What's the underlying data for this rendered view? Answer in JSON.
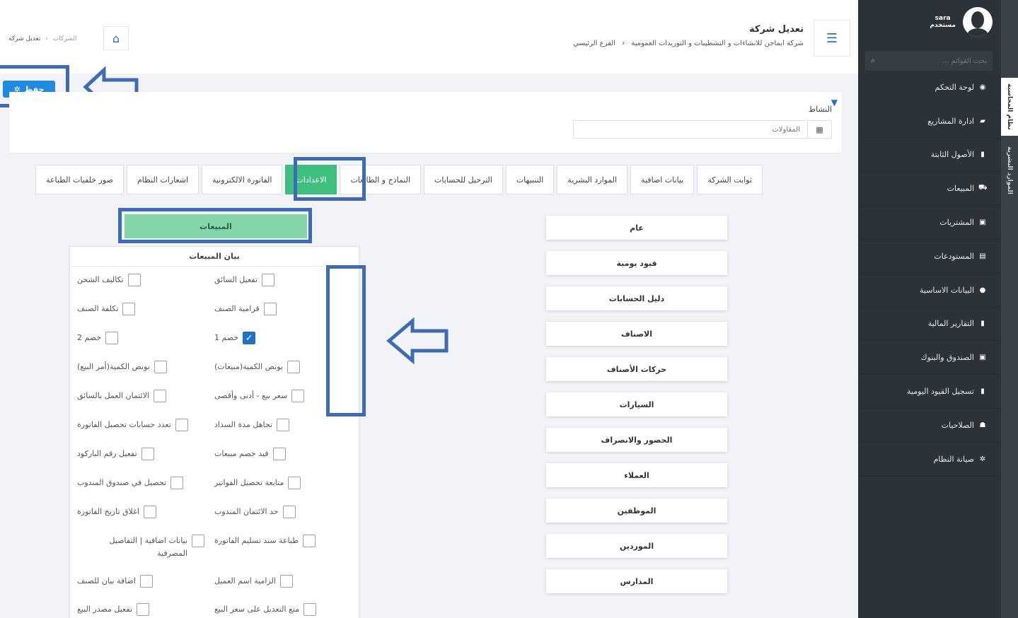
{
  "colors": {
    "accent": "#1e73c8",
    "tab_active": "#3fbf7f",
    "sales_button": "#82d6aa",
    "sidebar": "#2c3338",
    "highlight": "#3f6bb5"
  },
  "sidebar": {
    "user_name": "sara",
    "user_role": "مستخدم",
    "search_placeholder": "بحث القوائم ...",
    "rail_tabs": [
      "نظام المحاسبة",
      "الموارد البشرية"
    ],
    "items": [
      {
        "label": "لوحة التحكم",
        "icon": "dashboard-icon"
      },
      {
        "label": "ادارة المشاريع",
        "icon": "projects-icon"
      },
      {
        "label": "الأصول الثابتة",
        "icon": "file-icon"
      },
      {
        "label": "المبيعات",
        "icon": "truck-icon"
      },
      {
        "label": "المشتريات",
        "icon": "money-icon"
      },
      {
        "label": "المستودعات",
        "icon": "archive-icon"
      },
      {
        "label": "البيانات الاساسية",
        "icon": "info-icon"
      },
      {
        "label": "التقارير المالية",
        "icon": "report-icon"
      },
      {
        "label": "الصندوق والبنوك",
        "icon": "bank-icon"
      },
      {
        "label": "تسجيل القيود اليومية",
        "icon": "journal-icon"
      },
      {
        "label": "الصلاحيات",
        "icon": "users-icon"
      },
      {
        "label": "صيانة النظام",
        "icon": "gear-icon"
      }
    ]
  },
  "header": {
    "title": "تعديل شركة",
    "subtitle_company": "شركة ايماجن للانشاءات و التشطيبات و التوريدات العمومية",
    "subtitle_branch": "الفرع الرئيسي",
    "breadcrumb": {
      "parent": "الشركات",
      "current": "تعديل شركة"
    }
  },
  "toolbar": {
    "save_label": "حفظ"
  },
  "activity": {
    "label": "النشاط",
    "value": "المقاولات"
  },
  "tabs": [
    "ثوابت الشركة",
    "بيانات اضافية",
    "الموارد البشرية",
    "التنبيهات",
    "الترحيل للحسابات",
    "النماذج و الطابعات",
    "الاعدادات",
    "الفاتورة الالكترونية",
    "اشعارات النظام",
    "صور خلفيات الطباعة"
  ],
  "active_tab": "الاعدادات",
  "categories": [
    "عام",
    "قيود يومية",
    "دليل الحسابات",
    "الاصناف",
    "حركات الأصناف",
    "السيارات",
    "الحضور والانصراف",
    "العملاء",
    "الموظفين",
    "الموردين",
    "المدارس"
  ],
  "sales": {
    "button": "المبيعات",
    "card_title": "بيان المبيعات",
    "right_options": [
      {
        "label": "تفعيل السائق",
        "checked": false
      },
      {
        "label": "قرامية الصنف",
        "checked": false
      },
      {
        "label": "خصم 1",
        "checked": true
      },
      {
        "label": "بونص الكمية(مبيعات)",
        "checked": false
      },
      {
        "label": "سعر بيع - أدنى وأقصى",
        "checked": false
      },
      {
        "label": "تجاهل مدة السداد",
        "checked": false
      },
      {
        "label": "قيد خصم مبيعات",
        "checked": false
      },
      {
        "label": "متابعة تحصيل الفواتير",
        "checked": false
      },
      {
        "label": "حد الائتمان المندوب",
        "checked": false
      },
      {
        "label": "طباعة سند تسليم الفاتورة",
        "checked": false
      },
      {
        "label": "الزامية اسم العميل",
        "checked": false
      },
      {
        "label": "منع التعديل على سعر البيع",
        "checked": false
      }
    ],
    "left_options": [
      {
        "label": "تكاليف الشحن",
        "checked": false
      },
      {
        "label": "تكلفة الصنف",
        "checked": false
      },
      {
        "label": "خصم 2",
        "checked": false
      },
      {
        "label": "بونص الكمية(أمر البيع)",
        "checked": false
      },
      {
        "label": "الائتمان العمل بالسائق",
        "checked": false
      },
      {
        "label": "تعدد حسابات تحصيل الفاتورة",
        "checked": false
      },
      {
        "label": "تفعيل رقم الباركود",
        "checked": false
      },
      {
        "label": "تحصيل في صندوق المندوب",
        "checked": false
      },
      {
        "label": "اغلاق تاريخ الفاتورة",
        "checked": false
      },
      {
        "label": "بيانات اضافية | التفاصيل المصرفية",
        "checked": false
      },
      {
        "label": "اضافة بيان للصنف",
        "checked": false
      },
      {
        "label": "تفعيل مصدر البيع",
        "checked": false
      }
    ]
  }
}
